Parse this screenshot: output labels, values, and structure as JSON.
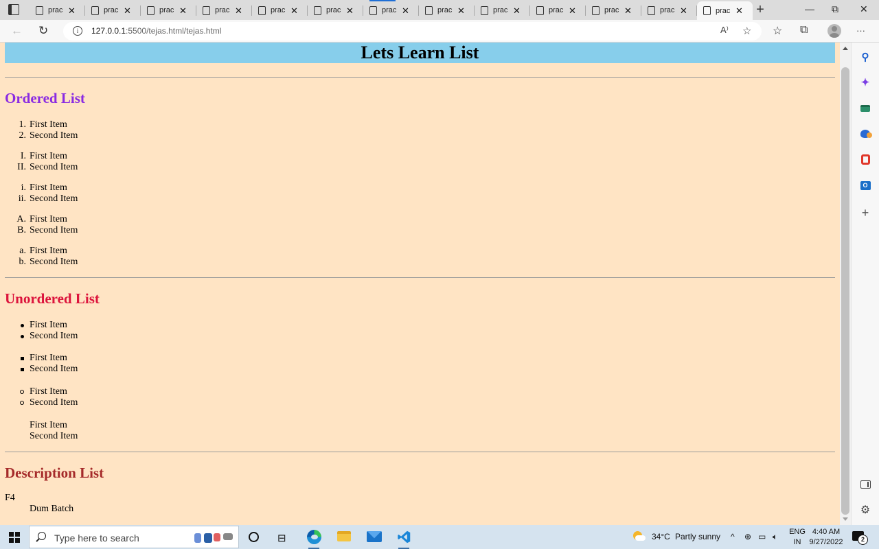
{
  "browser": {
    "tabs": [
      {
        "title": "prac",
        "active": false
      },
      {
        "title": "prac",
        "active": false
      },
      {
        "title": "prac",
        "active": false
      },
      {
        "title": "prac",
        "active": false
      },
      {
        "title": "prac",
        "active": false
      },
      {
        "title": "prac",
        "active": false
      },
      {
        "title": "prac",
        "active": false
      },
      {
        "title": "prac",
        "active": false
      },
      {
        "title": "prac",
        "active": false
      },
      {
        "title": "prac",
        "active": false
      },
      {
        "title": "prac",
        "active": false
      },
      {
        "title": "prac",
        "active": false
      },
      {
        "title": "prac",
        "active": true
      }
    ],
    "tab_close_glyph": "✕",
    "new_tab_glyph": "+",
    "window_controls": {
      "minimize": "—",
      "restore": "⧉",
      "close": "✕"
    },
    "url_host": "127.0.0.1",
    "url_rest": ":5500/tejas.html/tejas.html",
    "toolbar_icons": [
      "back-icon",
      "refresh-icon",
      "read-aloud-icon",
      "favorite-add-icon",
      "favorites-icon",
      "collections-icon",
      "profile-icon",
      "more-icon"
    ],
    "more_glyph": "···",
    "read_aloud_glyph": "A⁾"
  },
  "page": {
    "title": "Lets Learn List",
    "colors": {
      "background": "#ffe4c4",
      "header_bg": "#87ceeb",
      "ordered_heading": "#8a2be2",
      "unordered_heading": "#dc143c",
      "description_heading": "#a52a2a"
    },
    "ordered": {
      "heading": "Ordered List",
      "lists": [
        {
          "type": "decimal",
          "items": [
            {
              "marker": "1.",
              "text": "First Item"
            },
            {
              "marker": "2.",
              "text": "Second Item"
            }
          ]
        },
        {
          "type": "upper-roman",
          "items": [
            {
              "marker": "I.",
              "text": "First Item"
            },
            {
              "marker": "II.",
              "text": "Second Item"
            }
          ]
        },
        {
          "type": "lower-roman",
          "items": [
            {
              "marker": "i.",
              "text": "First Item"
            },
            {
              "marker": "ii.",
              "text": "Second Item"
            }
          ]
        },
        {
          "type": "upper-alpha",
          "items": [
            {
              "marker": "A.",
              "text": "First Item"
            },
            {
              "marker": "B.",
              "text": "Second Item"
            }
          ]
        },
        {
          "type": "lower-alpha",
          "items": [
            {
              "marker": "a.",
              "text": "First Item"
            },
            {
              "marker": "b.",
              "text": "Second Item"
            }
          ]
        }
      ]
    },
    "unordered": {
      "heading": "Unordered List",
      "lists": [
        {
          "type": "disc",
          "items": [
            "First Item",
            "Second Item"
          ]
        },
        {
          "type": "square",
          "items": [
            "First Item",
            "Second Item"
          ]
        },
        {
          "type": "circle",
          "items": [
            "First Item",
            "Second Item"
          ]
        },
        {
          "type": "none",
          "items": [
            "First Item",
            "Second Item"
          ]
        }
      ]
    },
    "description": {
      "heading": "Description List",
      "term": "F4",
      "definition": "Dum Batch"
    }
  },
  "sidebar_icons": [
    "search-icon",
    "copilot-icon",
    "shopping-icon",
    "games-icon",
    "office-icon",
    "outlook-icon",
    "add-icon",
    "hide-sidebar-icon",
    "settings-icon"
  ],
  "taskbar": {
    "search_placeholder": "Type here to search",
    "apps": [
      "edge",
      "file-explorer",
      "mail",
      "vs-code"
    ],
    "weather_temp": "34°C",
    "weather_text": "Partly sunny",
    "lang_top": "ENG",
    "lang_bottom": "IN",
    "time": "4:40 AM",
    "date": "9/27/2022",
    "notification_count": "2"
  }
}
